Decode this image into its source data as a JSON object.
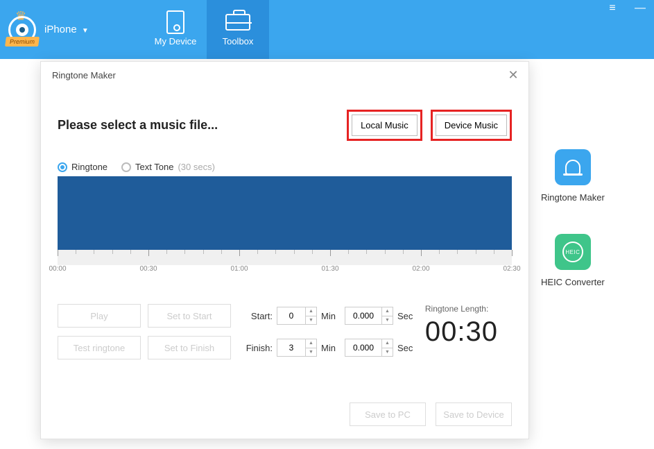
{
  "header": {
    "premium_label": "Premium",
    "device_name": "iPhone",
    "nav": {
      "my_device": "My Device",
      "toolbox": "Toolbox"
    }
  },
  "tiles": {
    "ringtone": "Ringtone Maker",
    "heic": "HEIC Converter",
    "heic_badge": "HEIC"
  },
  "modal": {
    "title": "Ringtone Maker",
    "heading": "Please select a music file...",
    "source": {
      "local": "Local Music",
      "device": "Device Music"
    },
    "type": {
      "ringtone": "Ringtone",
      "text_tone": "Text Tone",
      "text_tone_suffix": "(30 secs)"
    },
    "timeline_labels": [
      "00:00",
      "00:30",
      "01:00",
      "01:30",
      "02:00",
      "02:30"
    ],
    "buttons": {
      "play": "Play",
      "test": "Test ringtone",
      "set_start": "Set to Start",
      "set_finish": "Set to Finish",
      "save_pc": "Save to PC",
      "save_device": "Save to Device"
    },
    "inputs": {
      "start_label": "Start:",
      "finish_label": "Finish:",
      "min_unit": "Min",
      "sec_unit": "Sec",
      "start_min": "0",
      "start_sec": "0.000",
      "finish_min": "3",
      "finish_sec": "0.000"
    },
    "length": {
      "label": "Ringtone Length:",
      "value": "00:30"
    }
  }
}
